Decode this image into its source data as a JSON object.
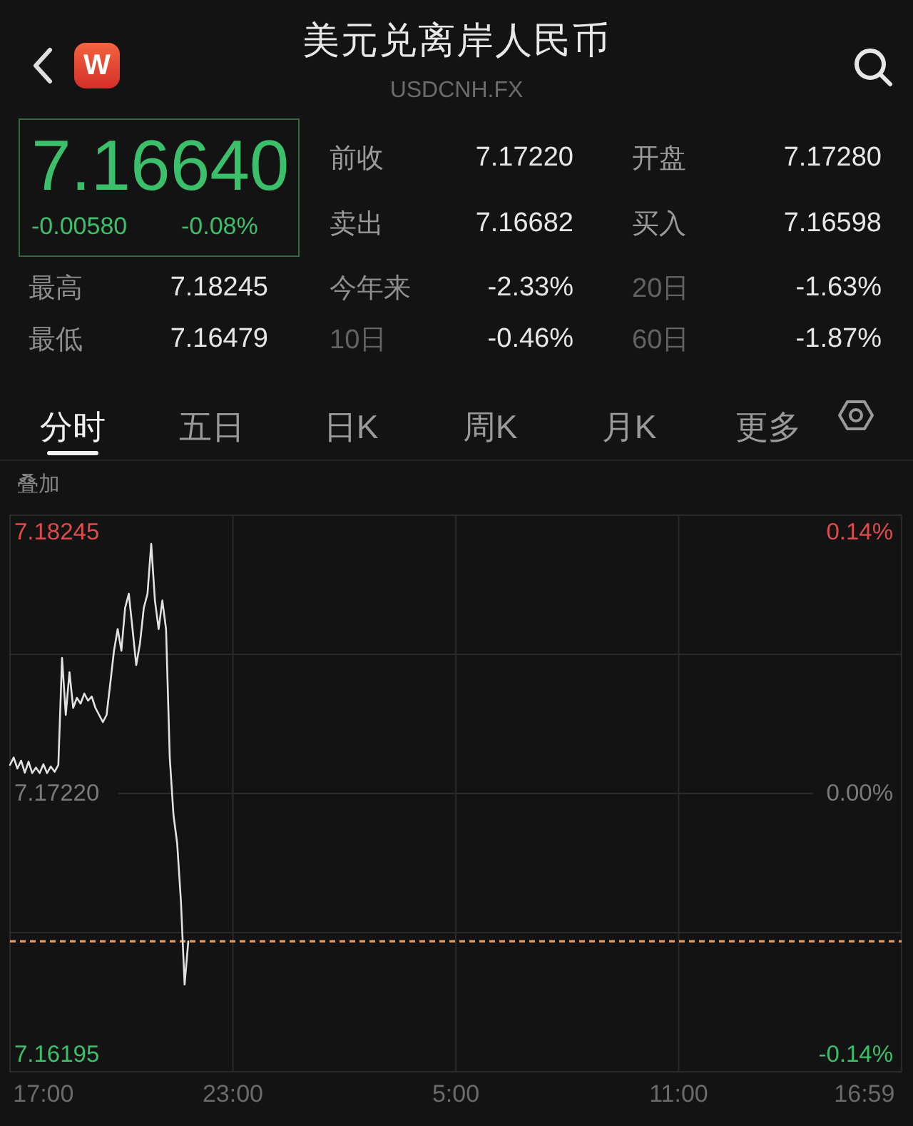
{
  "header": {
    "title": "美元兑离岸人民币",
    "subtitle": "USDCNH.FX",
    "logo": "W"
  },
  "quote": {
    "price": "7.16640",
    "change": "-0.00580",
    "change_percent": "-0.08%",
    "down": true,
    "fields": [
      {
        "label": "前收",
        "value": "7.17220"
      },
      {
        "label": "开盘",
        "value": "7.17280"
      },
      {
        "label": "卖出",
        "value": "7.16682"
      },
      {
        "label": "买入",
        "value": "7.16598"
      }
    ]
  },
  "stats": [
    {
      "label": "最高",
      "value": "7.18245",
      "muted": false
    },
    {
      "label": "今年来",
      "value": "-2.33%",
      "muted": false
    },
    {
      "label": "20日",
      "value": "-1.63%",
      "muted": true
    },
    {
      "label": "最低",
      "value": "7.16479",
      "muted": false
    },
    {
      "label": "10日",
      "value": "-0.46%",
      "muted": true
    },
    {
      "label": "60日",
      "value": "-1.87%",
      "muted": true
    }
  ],
  "tabs": [
    {
      "label": "分时",
      "selected": true
    },
    {
      "label": "五日",
      "selected": false
    },
    {
      "label": "日K",
      "selected": false
    },
    {
      "label": "周K",
      "selected": false
    },
    {
      "label": "月K",
      "selected": false
    },
    {
      "label": "更多",
      "selected": false
    }
  ],
  "chart_panel": {
    "overlay_label": "叠加",
    "percent_labels": [
      "0.14%",
      "0.00%",
      "-0.14%"
    ],
    "chart_data": {
      "type": "line",
      "categories": [
        null,
        null,
        null,
        null,
        null,
        null,
        null,
        null,
        null,
        "17:00",
        null,
        null,
        null,
        null,
        null,
        null,
        null,
        null,
        null,
        null,
        null,
        null,
        null,
        null,
        null,
        null,
        null,
        null,
        null,
        null,
        null,
        null,
        null,
        null,
        null,
        null,
        null,
        null,
        null,
        null,
        null,
        null,
        null,
        null,
        null,
        null,
        null,
        null,
        null,
        null,
        null,
        null,
        null,
        null,
        null,
        null,
        null,
        null,
        null,
        null,
        "23:00",
        null,
        null,
        null,
        null,
        null,
        null,
        null,
        null,
        null,
        null,
        null,
        null,
        null,
        null,
        null,
        null,
        null,
        null,
        null,
        null,
        null,
        null,
        null,
        null,
        null,
        null,
        null,
        null,
        null,
        null,
        null,
        null,
        null,
        null,
        null,
        null,
        null,
        null,
        null,
        null,
        null,
        null,
        null,
        null,
        null,
        null,
        null,
        null,
        null,
        null,
        null,
        null,
        null,
        null,
        null,
        null,
        null,
        null,
        null,
        "5:00",
        null,
        null,
        null,
        null,
        null,
        null,
        null,
        null,
        null,
        null,
        null,
        null,
        null,
        null,
        null,
        null,
        null,
        null,
        null,
        null,
        null,
        null,
        null,
        null,
        null,
        null,
        null,
        null,
        null,
        null,
        null,
        null,
        null,
        null,
        null,
        null,
        null,
        null,
        null,
        null,
        null,
        null,
        null,
        null,
        null,
        null,
        null,
        null,
        null,
        null,
        null,
        null,
        null,
        null,
        null,
        null,
        null,
        null,
        null,
        "11:00",
        null,
        null,
        null,
        null,
        null,
        null,
        null,
        null,
        null,
        null,
        null,
        null,
        null,
        null,
        null,
        null,
        null,
        null,
        null,
        null,
        null,
        null,
        null,
        null,
        null,
        null,
        null,
        null,
        null,
        null,
        null,
        null,
        null,
        null,
        null,
        null,
        null,
        null,
        null,
        null,
        null,
        null,
        null,
        null,
        null,
        null,
        null,
        null,
        null,
        "16:59",
        null,
        null,
        null,
        null,
        null,
        null,
        null,
        null,
        null,
        null
      ],
      "series": [
        {
          "color": "#e2e2e2",
          "values": [
            7.17332,
            7.17361,
            7.17318,
            7.17349,
            7.17302,
            7.17345,
            7.173,
            7.17322,
            7.173,
            7.17335,
            7.173,
            7.17326,
            7.17305,
            7.17332,
            7.17752,
            7.17528,
            7.17696,
            7.17556,
            7.17595,
            7.17573,
            7.17612,
            7.17584,
            7.176,
            7.17556,
            7.17528,
            7.175,
            7.17528,
            7.17652,
            7.1778,
            7.17865,
            7.1778,
            7.17948,
            7.18004,
            7.17865,
            7.17724,
            7.17808,
            7.17948,
            7.18004,
            7.182,
            7.17977,
            7.17865,
            7.17977,
            7.17865,
            7.17361,
            7.17136,
            7.17024,
            7.168,
            7.1647,
            7.1664,
            null,
            null,
            null,
            null,
            null,
            null,
            null,
            null,
            null,
            null,
            null,
            null,
            null,
            null,
            null,
            null,
            null,
            null,
            null,
            null,
            null,
            null,
            null,
            null,
            null,
            null,
            null,
            null,
            null,
            null,
            null,
            null,
            null,
            null,
            null,
            null,
            null,
            null,
            null,
            null,
            null,
            null,
            null,
            null,
            null,
            null,
            null,
            null,
            null,
            null,
            null,
            null,
            null,
            null,
            null,
            null,
            null,
            null,
            null,
            null,
            null,
            null,
            null,
            null,
            null,
            null,
            null,
            null,
            null,
            null,
            null,
            null,
            null,
            null,
            null,
            null,
            null,
            null,
            null,
            null,
            null,
            null,
            null,
            null,
            null,
            null,
            null,
            null,
            null,
            null,
            null,
            null,
            null,
            null,
            null,
            null,
            null,
            null,
            null,
            null,
            null,
            null,
            null,
            null,
            null,
            null,
            null,
            null,
            null,
            null,
            null,
            null,
            null,
            null,
            null,
            null,
            null,
            null,
            null,
            null,
            null,
            null,
            null,
            null,
            null,
            null,
            null,
            null,
            null,
            null,
            null,
            null,
            null,
            null,
            null,
            null,
            null,
            null,
            null,
            null,
            null,
            null,
            null,
            null,
            null,
            null,
            null,
            null,
            null,
            null,
            null,
            null,
            null,
            null,
            null,
            null,
            null,
            null,
            null,
            null,
            null,
            null,
            null,
            null,
            null,
            null,
            null,
            null,
            null,
            null,
            null,
            null,
            null,
            null,
            null,
            null,
            null,
            null,
            null,
            null,
            null,
            null,
            null,
            null,
            null,
            null,
            null,
            null,
            null,
            null,
            null,
            null
          ]
        }
      ],
      "ylim": [
        7.16128,
        7.18312
      ],
      "yticks": [
        {
          "value": 7.18245,
          "label": "7.18245"
        },
        {
          "value": 7.1722,
          "label": "7.17220"
        },
        {
          "value": 7.16195,
          "label": "7.16195"
        }
      ],
      "ref_lines": [
        {
          "axis": "y",
          "value": 7.1664
        }
      ]
    }
  }
}
